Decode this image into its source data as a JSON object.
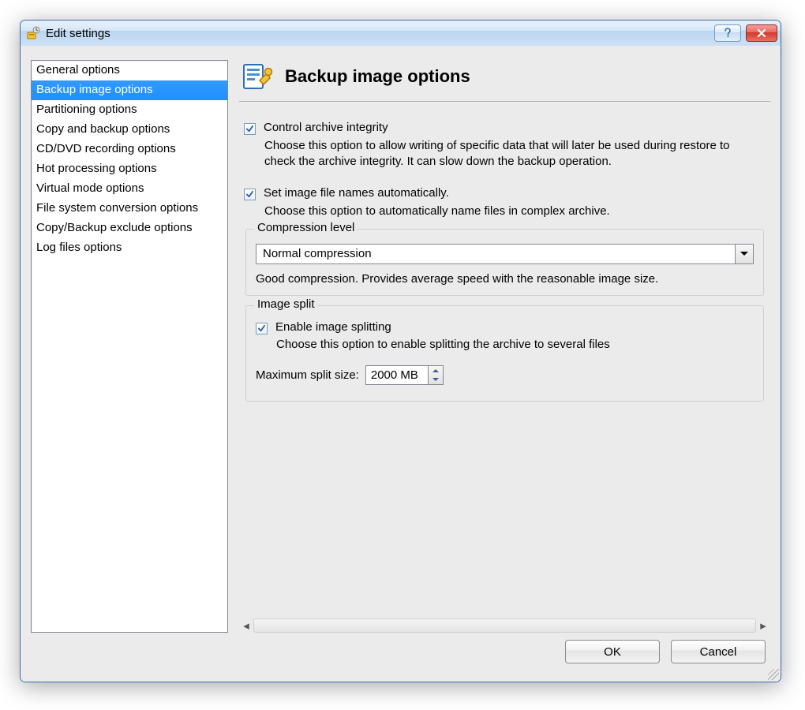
{
  "window": {
    "title": "Edit settings"
  },
  "sidebar": {
    "selected_index": 1,
    "items": [
      {
        "label": "General options"
      },
      {
        "label": "Backup image options"
      },
      {
        "label": "Partitioning options"
      },
      {
        "label": "Copy and backup options"
      },
      {
        "label": "CD/DVD recording options"
      },
      {
        "label": "Hot processing options"
      },
      {
        "label": "Virtual mode options"
      },
      {
        "label": "File system conversion options"
      },
      {
        "label": "Copy/Backup exclude options"
      },
      {
        "label": "Log files options"
      }
    ]
  },
  "main": {
    "heading": "Backup image options",
    "opt_integrity": {
      "checked": true,
      "label": "Control archive integrity",
      "desc": "Choose this option to allow writing of specific data that will later be used during restore to check the archive integrity. It can slow down the backup operation."
    },
    "opt_autoname": {
      "checked": true,
      "label": "Set image file names automatically.",
      "desc": "Choose this option to automatically name files in complex archive."
    },
    "compression": {
      "legend": "Compression level",
      "value": "Normal compression",
      "desc": "Good compression. Provides average speed with the reasonable image size."
    },
    "split": {
      "legend": "Image split",
      "enable": {
        "checked": true,
        "label": "Enable image splitting",
        "desc": "Choose this option to enable splitting the archive to several files"
      },
      "max_label": "Maximum split size:",
      "max_value": "2000 MB"
    }
  },
  "footer": {
    "ok": "OK",
    "cancel": "Cancel"
  }
}
